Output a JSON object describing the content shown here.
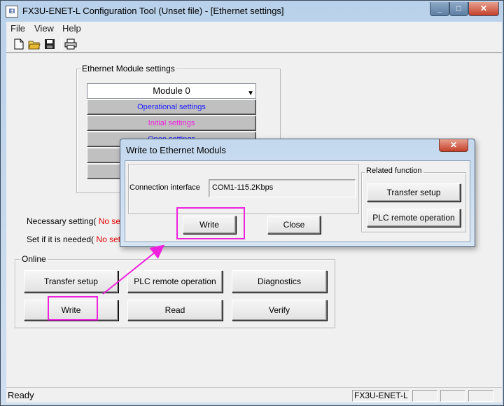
{
  "window": {
    "title": "FX3U-ENET-L Configuration Tool (Unset file) - [Ethernet settings]",
    "icon_text": "EI",
    "controls": [
      "_",
      "□",
      "✕"
    ]
  },
  "menu": {
    "items": [
      "File",
      "View",
      "Help"
    ]
  },
  "toolbar": {
    "icons": [
      "new-file-icon",
      "open-folder-icon",
      "save-icon",
      "print-icon"
    ]
  },
  "module_settings": {
    "group_label": "Ethernet Module settings",
    "module_select": "Module 0",
    "buttons": [
      {
        "label": "Operational settings",
        "color": "#1a1aff"
      },
      {
        "label": "Initial settings",
        "color": "#ee22dd"
      },
      {
        "label": "Open settings",
        "color": "#1a1aff"
      }
    ]
  },
  "necessary": {
    "label": "Necessary setting(",
    "value": "No setting"
  },
  "if_needed": {
    "label": "Set if it is needed(",
    "value": "No setting"
  },
  "online": {
    "group_label": "Online",
    "buttons": {
      "transfer_setup": "Transfer setup",
      "plc_remote": "PLC remote operation",
      "diagnostics": "Diagnostics",
      "write": "Write",
      "read": "Read",
      "verify": "Verify"
    }
  },
  "dialog": {
    "title": "Write to Ethernet Moduls",
    "close": "✕",
    "connection_label": "Connection interface",
    "connection_value": "COM1-115.2Kbps",
    "write": "Write",
    "close_button": "Close",
    "related_group": "Related function",
    "transfer_setup": "Transfer setup",
    "plc_remote": "PLC remote operation"
  },
  "status": {
    "text": "Ready",
    "panel": "FX3U-ENET-L"
  },
  "colors": {
    "highlight": "#ee22dd",
    "no_setting": "#e00000"
  }
}
